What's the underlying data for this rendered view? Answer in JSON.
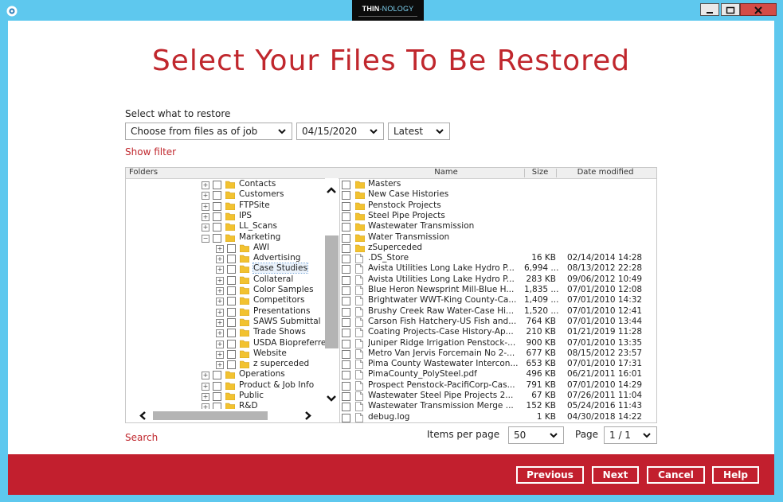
{
  "brand": {
    "name_a": "THIN",
    "name_b": "-NOLOGY"
  },
  "heading": "Select Your Files To Be Restored",
  "select_label": "Select what to restore",
  "dropdowns": {
    "job": "Choose from files as of job",
    "date": "04/15/2020",
    "version": "Latest"
  },
  "show_filter": "Show filter",
  "search": "Search",
  "folders_header": "Folders",
  "columns": {
    "name": "Name",
    "size": "Size",
    "date": "Date modified"
  },
  "tree": [
    {
      "label": "Contacts",
      "level": 0
    },
    {
      "label": "Customers",
      "level": 0
    },
    {
      "label": "FTPSite",
      "level": 0
    },
    {
      "label": "IPS",
      "level": 0
    },
    {
      "label": "LL_Scans",
      "level": 0
    },
    {
      "label": "Marketing",
      "level": 0,
      "expanded": true
    },
    {
      "label": "AWI",
      "level": 1
    },
    {
      "label": "Advertising",
      "level": 1
    },
    {
      "label": "Case Studies",
      "level": 1,
      "selected": true
    },
    {
      "label": "Collateral",
      "level": 1
    },
    {
      "label": "Color Samples",
      "level": 1
    },
    {
      "label": "Competitors",
      "level": 1
    },
    {
      "label": "Presentations",
      "level": 1
    },
    {
      "label": "SAWS Submittal",
      "level": 1
    },
    {
      "label": "Trade Shows",
      "level": 1
    },
    {
      "label": "USDA Biopreferred",
      "level": 1
    },
    {
      "label": "Website",
      "level": 1
    },
    {
      "label": "z superceded",
      "level": 1
    },
    {
      "label": "Operations",
      "level": 0
    },
    {
      "label": "Product & Job Info",
      "level": 0
    },
    {
      "label": "Public",
      "level": 0
    },
    {
      "label": "R&D",
      "level": 0
    }
  ],
  "files": [
    {
      "name": "Masters",
      "size": "",
      "date": "",
      "kind": "folder"
    },
    {
      "name": "New Case Histories",
      "size": "",
      "date": "",
      "kind": "folder"
    },
    {
      "name": "Penstock Projects",
      "size": "",
      "date": "",
      "kind": "folder"
    },
    {
      "name": "Steel Pipe Projects",
      "size": "",
      "date": "",
      "kind": "folder"
    },
    {
      "name": "Wastewater Transmission",
      "size": "",
      "date": "",
      "kind": "folder"
    },
    {
      "name": "Water Transmission",
      "size": "",
      "date": "",
      "kind": "folder"
    },
    {
      "name": "zSuperceded",
      "size": "",
      "date": "",
      "kind": "folder"
    },
    {
      "name": ".DS_Store",
      "size": "16 KB",
      "date": "02/14/2014 14:28",
      "kind": "file"
    },
    {
      "name": "Avista Utilities Long Lake Hydro P...",
      "size": "6,994 ...",
      "date": "08/13/2012 22:28",
      "kind": "file"
    },
    {
      "name": "Avista Utilities Long Lake Hydro P...",
      "size": "283 KB",
      "date": "09/06/2012 10:49",
      "kind": "file"
    },
    {
      "name": "Blue Heron Newsprint Mill-Blue H...",
      "size": "1,835 ...",
      "date": "07/01/2010 12:08",
      "kind": "file"
    },
    {
      "name": "Brightwater WWT-King County-Ca...",
      "size": "1,409 ...",
      "date": "07/01/2010 14:32",
      "kind": "file"
    },
    {
      "name": "Brushy Creek Raw Water-Case Hi...",
      "size": "1,520 ...",
      "date": "07/01/2010 12:41",
      "kind": "file"
    },
    {
      "name": "Carson Fish Hatchery-US Fish and...",
      "size": "764 KB",
      "date": "07/01/2010 13:44",
      "kind": "file"
    },
    {
      "name": "Coating Projects-Case History-Ap...",
      "size": "210 KB",
      "date": "01/21/2019 11:28",
      "kind": "file"
    },
    {
      "name": "Juniper Ridge Irrigation Penstock-...",
      "size": "900 KB",
      "date": "07/01/2010 13:35",
      "kind": "file"
    },
    {
      "name": "Metro Van Jervis Forcemain No 2-...",
      "size": "677 KB",
      "date": "08/15/2012 23:57",
      "kind": "file"
    },
    {
      "name": "Pima County Wastewater Intercon...",
      "size": "653 KB",
      "date": "07/01/2010 17:31",
      "kind": "file"
    },
    {
      "name": "PimaCounty_PolySteel.pdf",
      "size": "496 KB",
      "date": "06/21/2011 16:01",
      "kind": "file"
    },
    {
      "name": "Prospect Penstock-PacifiCorp-Cas...",
      "size": "791 KB",
      "date": "07/01/2010 14:29",
      "kind": "file"
    },
    {
      "name": "Wastewater Steel Pipe Projects 2...",
      "size": "67 KB",
      "date": "07/26/2011 11:04",
      "kind": "file"
    },
    {
      "name": "Wastewater Transmission Merge ...",
      "size": "152 KB",
      "date": "05/24/2016 11:43",
      "kind": "file"
    },
    {
      "name": "debug.log",
      "size": "1 KB",
      "date": "04/30/2018 14:22",
      "kind": "file"
    }
  ],
  "items_per_page_label": "Items per page",
  "items_per_page": "50",
  "page_label": "Page",
  "page_value": "1 / 1",
  "buttons": {
    "previous": "Previous",
    "next": "Next",
    "cancel": "Cancel",
    "help": "Help"
  },
  "colors": {
    "accent": "#c0272d",
    "footer": "#c21f2e",
    "frame": "#5ec8ee",
    "folder": "#f2c230"
  }
}
